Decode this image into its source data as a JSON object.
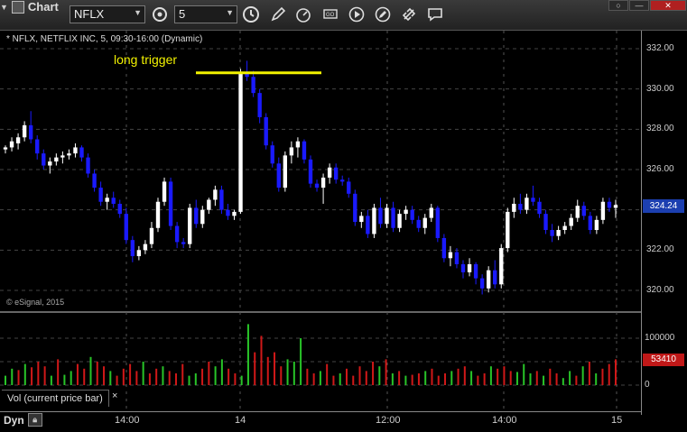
{
  "toolbar": {
    "app_title": "Chart",
    "symbol": "NFLX",
    "interval": "5",
    "tools": [
      "clock-icon",
      "pencil-icon",
      "speed-icon",
      "ticker-icon",
      "play-icon",
      "edit-icon",
      "link-icon",
      "comment-icon"
    ]
  },
  "chart": {
    "symbol_label": "* NFLX, NETFLIX INC, 5, 09:30-16:00 (Dynamic)",
    "annotation": "long trigger",
    "watermark": "© eSignal, 2015",
    "last_price": "324.24",
    "volume_legend": "Vol (current price bar)",
    "volume_close": "×",
    "last_volume": "53410",
    "dyn_label": "Dyn",
    "colors": {
      "up": "#ffffff",
      "down": "#1a1aff",
      "vol_up": "#28c428",
      "vol_down": "#d01818",
      "trigger": "#f2f200"
    }
  },
  "chart_data": {
    "type": "candlestick",
    "price_axis": {
      "ticks": [
        "332.00",
        "330.00",
        "328.00",
        "326.00",
        "324.00",
        "322.00",
        "320.00"
      ],
      "ylim": [
        319.2,
        333.0
      ]
    },
    "volume_axis": {
      "ticks": [
        "100000",
        "50000",
        "0"
      ],
      "ylim": [
        0,
        130000
      ]
    },
    "x_ticks": [
      "14:00",
      "14",
      "12:00",
      "14:00",
      "15"
    ],
    "trigger_price": 330.8,
    "candles": [
      [
        327.0,
        327.2,
        326.8,
        327.1
      ],
      [
        327.1,
        327.6,
        326.9,
        327.4
      ],
      [
        327.3,
        327.8,
        327.0,
        327.6
      ],
      [
        327.6,
        328.4,
        327.4,
        328.2
      ],
      [
        328.2,
        328.9,
        327.3,
        327.5
      ],
      [
        327.5,
        327.7,
        326.5,
        326.8
      ],
      [
        326.8,
        327.0,
        326.0,
        326.2
      ],
      [
        326.2,
        326.6,
        325.8,
        326.4
      ],
      [
        326.4,
        326.8,
        326.2,
        326.6
      ],
      [
        326.6,
        326.9,
        326.3,
        326.7
      ],
      [
        326.7,
        327.0,
        326.5,
        326.8
      ],
      [
        326.8,
        327.3,
        326.6,
        327.1
      ],
      [
        327.1,
        327.2,
        326.4,
        326.6
      ],
      [
        326.6,
        326.8,
        325.6,
        325.8
      ],
      [
        325.8,
        326.0,
        324.9,
        325.1
      ],
      [
        325.1,
        325.4,
        324.2,
        324.4
      ],
      [
        324.4,
        324.8,
        324.0,
        324.6
      ],
      [
        324.6,
        324.9,
        324.1,
        324.3
      ],
      [
        324.3,
        324.5,
        323.6,
        323.8
      ],
      [
        323.8,
        324.1,
        322.3,
        322.5
      ],
      [
        322.5,
        322.7,
        321.4,
        321.7
      ],
      [
        321.7,
        322.2,
        321.5,
        322.0
      ],
      [
        322.0,
        322.5,
        321.8,
        322.3
      ],
      [
        322.3,
        323.4,
        322.1,
        323.1
      ],
      [
        323.1,
        324.6,
        322.9,
        324.4
      ],
      [
        324.4,
        325.6,
        324.2,
        325.4
      ],
      [
        325.4,
        325.6,
        323.0,
        323.2
      ],
      [
        323.2,
        323.4,
        322.1,
        322.4
      ],
      [
        322.4,
        322.6,
        322.1,
        322.3
      ],
      [
        322.3,
        324.3,
        322.1,
        324.1
      ],
      [
        324.1,
        324.5,
        323.1,
        323.3
      ],
      [
        323.3,
        324.2,
        323.1,
        324.0
      ],
      [
        324.0,
        324.6,
        323.8,
        324.5
      ],
      [
        324.5,
        325.2,
        324.2,
        325.0
      ],
      [
        325.0,
        325.2,
        323.8,
        324.0
      ],
      [
        324.0,
        324.3,
        323.5,
        323.7
      ],
      [
        323.7,
        324.0,
        323.5,
        323.9
      ],
      [
        323.9,
        331.0,
        323.8,
        330.8
      ],
      [
        330.8,
        331.4,
        330.4,
        330.6
      ],
      [
        330.6,
        330.9,
        329.6,
        329.8
      ],
      [
        329.8,
        330.0,
        328.3,
        328.6
      ],
      [
        328.6,
        328.8,
        327.0,
        327.2
      ],
      [
        327.2,
        327.4,
        326.1,
        326.3
      ],
      [
        326.3,
        326.6,
        324.9,
        325.1
      ],
      [
        325.1,
        326.9,
        324.9,
        326.7
      ],
      [
        326.7,
        327.4,
        326.3,
        327.1
      ],
      [
        327.1,
        327.6,
        326.6,
        327.4
      ],
      [
        327.4,
        327.5,
        326.3,
        326.5
      ],
      [
        326.5,
        326.7,
        325.1,
        325.3
      ],
      [
        325.3,
        325.5,
        324.9,
        325.1
      ],
      [
        325.1,
        325.8,
        324.3,
        325.6
      ],
      [
        325.6,
        326.3,
        325.3,
        326.1
      ],
      [
        326.1,
        326.3,
        325.3,
        325.5
      ],
      [
        325.5,
        325.7,
        325.2,
        325.4
      ],
      [
        325.4,
        325.6,
        324.6,
        324.8
      ],
      [
        324.8,
        325.0,
        323.2,
        323.4
      ],
      [
        323.4,
        323.9,
        323.1,
        323.7
      ],
      [
        323.7,
        324.0,
        322.6,
        322.8
      ],
      [
        322.8,
        324.3,
        322.6,
        324.1
      ],
      [
        324.1,
        324.6,
        323.1,
        323.3
      ],
      [
        323.3,
        324.3,
        323.1,
        324.1
      ],
      [
        324.1,
        324.4,
        322.9,
        323.1
      ],
      [
        323.1,
        324.0,
        322.9,
        323.8
      ],
      [
        323.8,
        324.2,
        323.5,
        324.0
      ],
      [
        324.0,
        324.2,
        323.3,
        323.5
      ],
      [
        323.5,
        323.7,
        322.9,
        323.1
      ],
      [
        323.1,
        323.8,
        322.8,
        323.6
      ],
      [
        323.6,
        324.3,
        323.4,
        324.1
      ],
      [
        324.1,
        324.2,
        322.4,
        322.6
      ],
      [
        322.6,
        322.8,
        321.4,
        321.6
      ],
      [
        321.6,
        322.2,
        321.2,
        321.9
      ],
      [
        321.9,
        322.1,
        321.1,
        321.3
      ],
      [
        321.3,
        321.5,
        320.6,
        320.9
      ],
      [
        320.9,
        321.6,
        320.7,
        321.3
      ],
      [
        321.3,
        321.4,
        320.3,
        320.6
      ],
      [
        320.6,
        320.8,
        319.8,
        320.1
      ],
      [
        320.1,
        321.2,
        319.9,
        321.0
      ],
      [
        321.0,
        321.5,
        320.1,
        320.3
      ],
      [
        320.3,
        322.3,
        320.1,
        322.1
      ],
      [
        322.1,
        324.1,
        321.9,
        323.9
      ],
      [
        323.9,
        324.6,
        323.6,
        324.3
      ],
      [
        324.3,
        324.8,
        323.8,
        324.0
      ],
      [
        324.0,
        324.8,
        323.8,
        324.6
      ],
      [
        324.6,
        325.2,
        324.2,
        324.4
      ],
      [
        324.4,
        324.6,
        323.6,
        323.8
      ],
      [
        323.8,
        324.0,
        322.8,
        323.0
      ],
      [
        323.0,
        323.3,
        322.4,
        322.7
      ],
      [
        322.7,
        323.2,
        322.5,
        323.0
      ],
      [
        323.0,
        323.4,
        322.8,
        323.2
      ],
      [
        323.2,
        323.8,
        323.0,
        323.6
      ],
      [
        323.6,
        324.5,
        323.4,
        324.2
      ],
      [
        324.2,
        324.4,
        323.5,
        323.7
      ],
      [
        323.7,
        323.9,
        322.8,
        323.0
      ],
      [
        323.0,
        323.7,
        322.8,
        323.5
      ],
      [
        323.5,
        324.6,
        323.3,
        324.4
      ],
      [
        324.4,
        324.6,
        323.9,
        324.1
      ],
      [
        324.1,
        324.5,
        323.6,
        324.24
      ]
    ],
    "volumes": [
      [
        20000,
        0
      ],
      [
        35000,
        0
      ],
      [
        32000,
        1
      ],
      [
        45000,
        0
      ],
      [
        38000,
        1
      ],
      [
        50000,
        1
      ],
      [
        40000,
        1
      ],
      [
        20000,
        0
      ],
      [
        55000,
        1
      ],
      [
        22000,
        0
      ],
      [
        30000,
        0
      ],
      [
        45000,
        1
      ],
      [
        35000,
        1
      ],
      [
        60000,
        0
      ],
      [
        50000,
        1
      ],
      [
        40000,
        1
      ],
      [
        30000,
        0
      ],
      [
        20000,
        1
      ],
      [
        35000,
        1
      ],
      [
        45000,
        1
      ],
      [
        30000,
        1
      ],
      [
        50000,
        0
      ],
      [
        25000,
        1
      ],
      [
        35000,
        1
      ],
      [
        40000,
        0
      ],
      [
        30000,
        1
      ],
      [
        25000,
        1
      ],
      [
        45000,
        1
      ],
      [
        20000,
        0
      ],
      [
        25000,
        0
      ],
      [
        35000,
        1
      ],
      [
        50000,
        1
      ],
      [
        40000,
        0
      ],
      [
        55000,
        0
      ],
      [
        35000,
        1
      ],
      [
        25000,
        1
      ],
      [
        20000,
        0
      ],
      [
        130000,
        0
      ],
      [
        70000,
        1
      ],
      [
        105000,
        1
      ],
      [
        60000,
        1
      ],
      [
        70000,
        1
      ],
      [
        40000,
        1
      ],
      [
        55000,
        0
      ],
      [
        50000,
        0
      ],
      [
        100000,
        0
      ],
      [
        35000,
        1
      ],
      [
        25000,
        1
      ],
      [
        30000,
        0
      ],
      [
        45000,
        1
      ],
      [
        20000,
        1
      ],
      [
        25000,
        0
      ],
      [
        35000,
        1
      ],
      [
        20000,
        1
      ],
      [
        40000,
        1
      ],
      [
        30000,
        1
      ],
      [
        50000,
        1
      ],
      [
        40000,
        0
      ],
      [
        55000,
        1
      ],
      [
        25000,
        0
      ],
      [
        30000,
        1
      ],
      [
        20000,
        0
      ],
      [
        22000,
        1
      ],
      [
        25000,
        1
      ],
      [
        30000,
        0
      ],
      [
        35000,
        1
      ],
      [
        20000,
        1
      ],
      [
        25000,
        1
      ],
      [
        30000,
        0
      ],
      [
        35000,
        1
      ],
      [
        40000,
        1
      ],
      [
        30000,
        0
      ],
      [
        20000,
        1
      ],
      [
        25000,
        1
      ],
      [
        40000,
        0
      ],
      [
        35000,
        1
      ],
      [
        40000,
        1
      ],
      [
        30000,
        1
      ],
      [
        28000,
        0
      ],
      [
        45000,
        0
      ],
      [
        25000,
        0
      ],
      [
        30000,
        1
      ],
      [
        20000,
        0
      ],
      [
        35000,
        1
      ],
      [
        25000,
        1
      ],
      [
        15000,
        0
      ],
      [
        30000,
        0
      ],
      [
        20000,
        1
      ],
      [
        40000,
        0
      ],
      [
        50000,
        1
      ],
      [
        25000,
        0
      ],
      [
        35000,
        1
      ],
      [
        45000,
        1
      ],
      [
        55000,
        1
      ]
    ]
  }
}
